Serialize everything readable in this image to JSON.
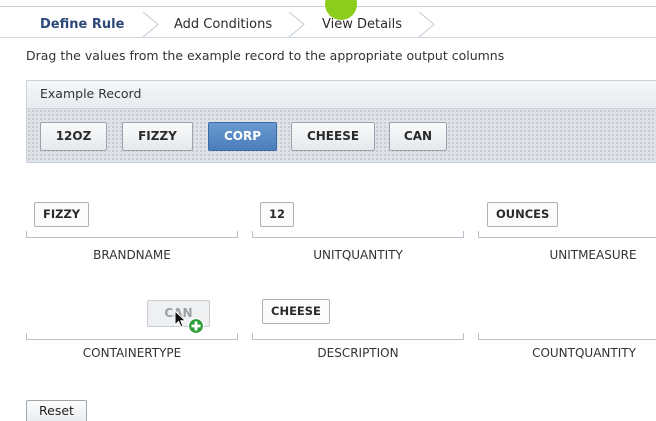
{
  "wizard": {
    "steps": [
      "Define Rule",
      "Add Conditions",
      "View Details"
    ],
    "active_step": "Define Rule"
  },
  "instructions": "Drag the values from the example record to the appropriate output columns",
  "example_record": {
    "title": "Example Record",
    "values": [
      "12OZ",
      "FIZZY",
      "CORP",
      "CHEESE",
      "CAN"
    ],
    "selected": "CORP"
  },
  "output_columns": [
    {
      "label": "BRANDNAME",
      "value": "FIZZY"
    },
    {
      "label": "UNITQUANTITY",
      "value": "12"
    },
    {
      "label": "UNITMEASURE",
      "value": "OUNCES"
    },
    {
      "label": "CONTAINERTYPE",
      "value": ""
    },
    {
      "label": "DESCRIPTION",
      "value": "CHEESE"
    },
    {
      "label": "COUNTQUANTITY",
      "value": ""
    }
  ],
  "drag_item": {
    "value": "CAN"
  },
  "buttons": {
    "reset": "Reset"
  },
  "colors": {
    "accent": "#4a7dbb",
    "active_step": "#2c4a78",
    "indicator": "#8ccc1a",
    "add_badge": "#2e9e3a"
  },
  "icons": {
    "cursor": "arrow-cursor-icon",
    "add": "plus-circle-icon"
  }
}
